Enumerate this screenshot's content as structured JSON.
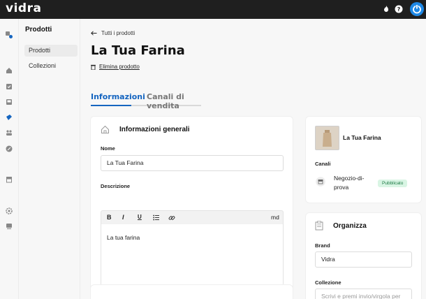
{
  "app": {
    "logo": "vidra"
  },
  "subnav": {
    "title": "Prodotti",
    "items": [
      {
        "label": "Prodotti",
        "active": true
      },
      {
        "label": "Collezioni",
        "active": false
      }
    ]
  },
  "page": {
    "back_label": "Tutti i prodotti",
    "title": "La Tua Farina",
    "delete_label": "Elimina prodotto"
  },
  "tabs": [
    {
      "label": "Informazioni",
      "active": true
    },
    {
      "label": "Canali di vendita",
      "active": false
    }
  ],
  "general": {
    "title": "Informazioni generali",
    "name_label": "Nome",
    "name_value": "La Tua Farina",
    "description_label": "Descrizione",
    "description_value": "La tua farina",
    "md_label": "md"
  },
  "product_card": {
    "name": "La Tua Farina",
    "channels_label": "Canali",
    "channel_name": "Negozio-di-prova",
    "channel_line1": "Negozio-di-",
    "channel_line2": "prova",
    "status": "Pubblicato"
  },
  "organize": {
    "title": "Organizza",
    "brand_label": "Brand",
    "brand_value": "Vidra",
    "collection_label": "Collezione",
    "collection_placeholder": "Scrivi e premi invio/virgola per"
  },
  "colors": {
    "accent": "#1565c0",
    "topbar": "#1f1f1f",
    "badge_bg": "#d9f5e4",
    "badge_text": "#1e7a45"
  }
}
